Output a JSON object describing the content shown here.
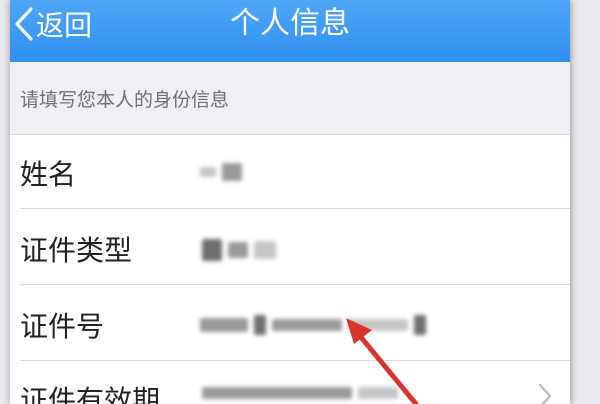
{
  "nav": {
    "back_label": "返回",
    "title": "个人信息",
    "color": "#3a96f2"
  },
  "hint": {
    "text": "请填写您本人的身份信息"
  },
  "rows": [
    {
      "label": "姓名"
    },
    {
      "label": "证件类型"
    },
    {
      "label": "证件号"
    },
    {
      "label": "证件有效期"
    }
  ],
  "annotation": {
    "color": "#d9352f"
  }
}
